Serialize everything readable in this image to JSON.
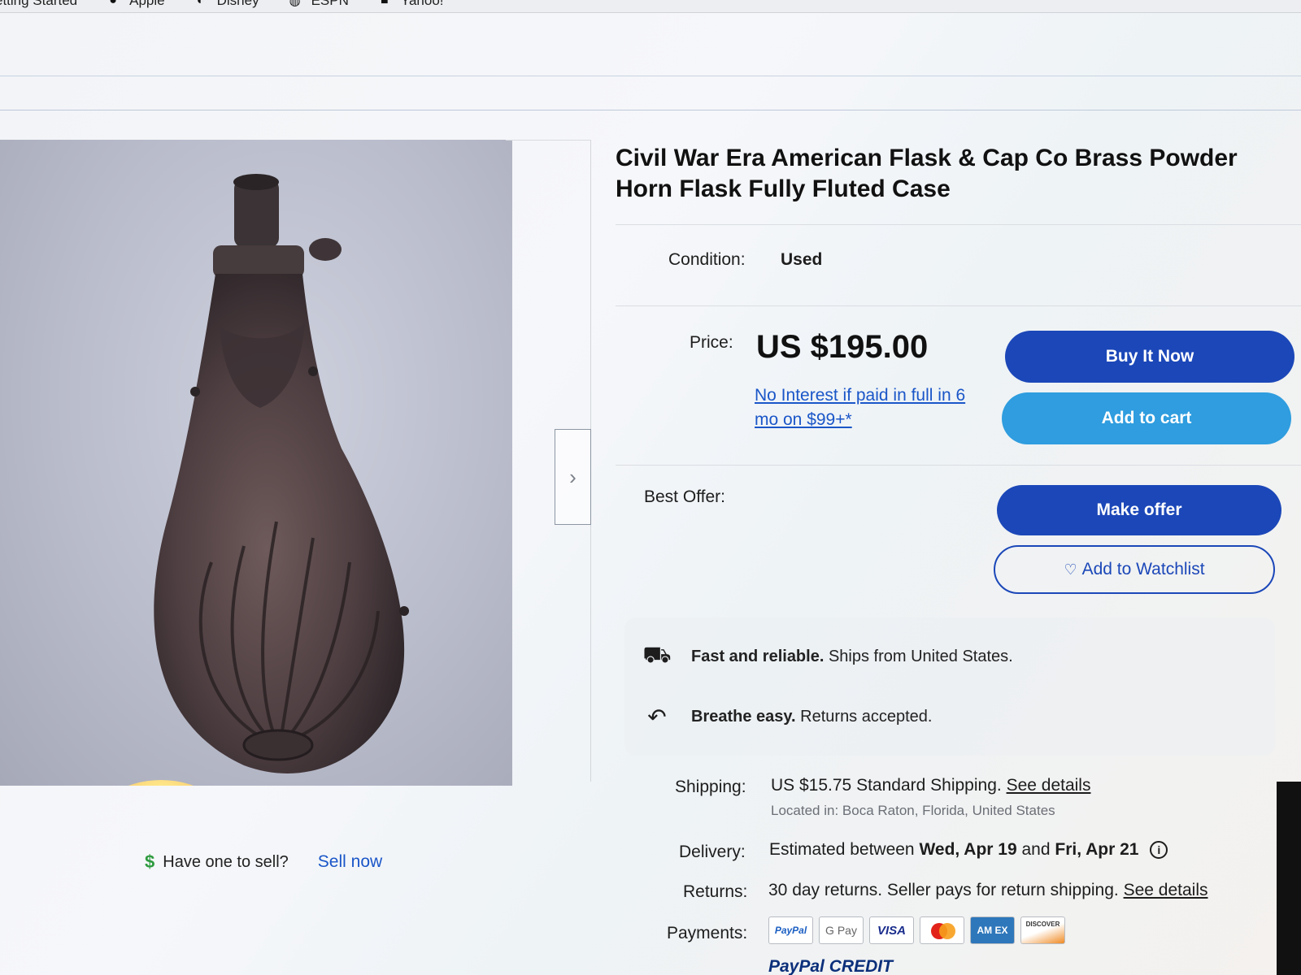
{
  "bookmarks": [
    {
      "label": "etting Started",
      "icon": "none"
    },
    {
      "label": "Apple",
      "icon": "apple-icon"
    },
    {
      "label": "Disney",
      "icon": "disney-icon"
    },
    {
      "label": "ESPN",
      "icon": "globe-icon"
    },
    {
      "label": "Yahoo!",
      "icon": "yahoo-icon"
    }
  ],
  "listing": {
    "title": "Civil War Era American Flask & Cap Co Brass Powder Horn Flask Fully Fluted Case",
    "condition_label": "Condition:",
    "condition_value": "Used",
    "price_label": "Price:",
    "price": "US $195.00",
    "financing": "No Interest if paid in full in 6 mo on $99+*",
    "best_offer_label": "Best Offer:"
  },
  "buttons": {
    "buy_now": "Buy It Now",
    "add_to_cart": "Add to cart",
    "make_offer": "Make offer",
    "add_to_watchlist": "Add to Watchlist"
  },
  "promos": [
    {
      "icon": "truck-icon",
      "bold": "Fast and reliable.",
      "text": "Ships from United States."
    },
    {
      "icon": "return-arrow-icon",
      "bold": "Breathe easy.",
      "text": "Returns accepted."
    }
  ],
  "shipping": {
    "label": "Shipping:",
    "value": "US $15.75 Standard Shipping.",
    "link": "See details",
    "location": "Located in: Boca Raton, Florida, United States"
  },
  "delivery": {
    "label": "Delivery:",
    "prefix": "Estimated between",
    "from": "Wed, Apr 19",
    "and": "and",
    "to": "Fri, Apr 21"
  },
  "returns": {
    "label": "Returns:",
    "value": "30 day returns. Seller pays for return shipping.",
    "link": "See details"
  },
  "payments": {
    "label": "Payments:",
    "methods": [
      "PayPal",
      "G Pay",
      "VISA",
      "",
      "AM EX",
      "DISCOVER"
    ],
    "paypal_credit_a": "PayPal",
    "paypal_credit_b": "CREDIT"
  },
  "sell": {
    "question": "Have one to sell?",
    "link": "Sell now"
  },
  "colors": {
    "primary_blue": "#1b47b8",
    "cart_blue": "#2f9ddf",
    "link_blue": "#1a56c8"
  }
}
